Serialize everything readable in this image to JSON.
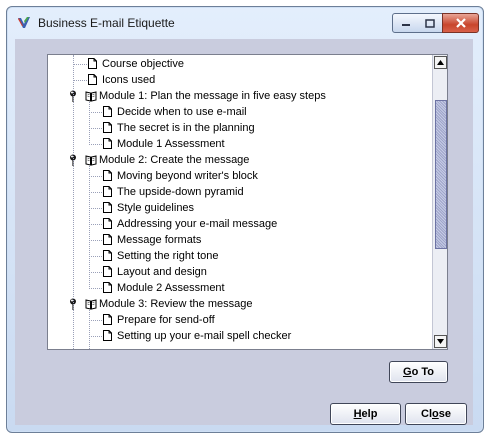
{
  "window": {
    "title": "Business E-mail Etiquette",
    "accent_close": "#c8452c"
  },
  "tree": {
    "items": [
      {
        "label": "Course objective",
        "kind": "doc"
      },
      {
        "label": "Icons used",
        "kind": "doc"
      },
      {
        "label": "Module 1: Plan the message in five easy steps",
        "kind": "module"
      },
      {
        "label": "Decide when to use e-mail",
        "kind": "doc"
      },
      {
        "label": "The secret is in the planning",
        "kind": "doc"
      },
      {
        "label": "Module 1 Assessment",
        "kind": "doc"
      },
      {
        "label": "Module 2: Create the message",
        "kind": "module"
      },
      {
        "label": "Moving beyond writer's block",
        "kind": "doc"
      },
      {
        "label": "The upside-down pyramid",
        "kind": "doc"
      },
      {
        "label": "Style guidelines",
        "kind": "doc"
      },
      {
        "label": "Addressing your e-mail message",
        "kind": "doc"
      },
      {
        "label": "Message formats",
        "kind": "doc"
      },
      {
        "label": "Setting the right tone",
        "kind": "doc"
      },
      {
        "label": "Layout and design",
        "kind": "doc"
      },
      {
        "label": "Module 2 Assessment",
        "kind": "doc"
      },
      {
        "label": "Module 3: Review the message",
        "kind": "module"
      },
      {
        "label": "Prepare for send-off",
        "kind": "doc"
      },
      {
        "label": "Setting up your e-mail spell checker",
        "kind": "doc"
      }
    ]
  },
  "buttons": {
    "goto": {
      "accel": "G",
      "rest": "o To"
    },
    "help": {
      "accel": "H",
      "rest": "elp"
    },
    "close": {
      "pre": "Cl",
      "accel": "o",
      "rest": "se"
    }
  }
}
